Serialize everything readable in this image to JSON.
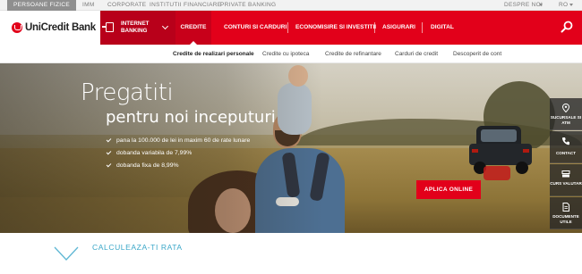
{
  "topbar": {
    "segments": [
      "PERSOANE FIZICE",
      "IMM",
      "CORPORATE",
      "INSTITUTII FINANCIARE",
      "PRIVATE BANKING"
    ],
    "about": "DESPRE NOI",
    "lang": "RO"
  },
  "logo": {
    "text": "UniCredit Bank"
  },
  "internet_banking": {
    "label": "INTERNET BANKING",
    "icon": "login-door-icon"
  },
  "nav": {
    "items": [
      "CREDITE",
      "CONTURI SI CARDURI",
      "ECONOMISIRE SI INVESTITII",
      "ASIGURARI",
      "DIGITAL"
    ],
    "active_index": 0,
    "search_icon": "search-icon"
  },
  "subnav": {
    "items": [
      "Credite de realizari personale",
      "Credite cu ipoteca",
      "Credite de refinantare",
      "Carduri de credit",
      "Descoperit de cont"
    ],
    "active_index": 0
  },
  "hero": {
    "title_line1": "Pregatiti",
    "title_line2": "pentru noi inceputuri",
    "bullets": [
      "pana la 100.000 de lei in maxim 60 de rate lunare",
      "dobanda variabila de 7,99%",
      "dobanda fixa de 8,99%"
    ],
    "cta": "APLICA ONLINE"
  },
  "rail": [
    {
      "label": "SUCURSALE SI ATM",
      "icon": "location-pin-icon"
    },
    {
      "label": "CONTACT",
      "icon": "phone-icon"
    },
    {
      "label": "CURS VALUTAR",
      "icon": "exchange-icon"
    },
    {
      "label": "DOCUMENTE UTILE",
      "icon": "document-icon"
    }
  ],
  "calculator": {
    "label": "CALCULEAZA-TI RATA"
  },
  "colors": {
    "brand_red": "#e2001a",
    "dark_red": "#b8001a",
    "accent_blue": "#3aa7c8"
  }
}
